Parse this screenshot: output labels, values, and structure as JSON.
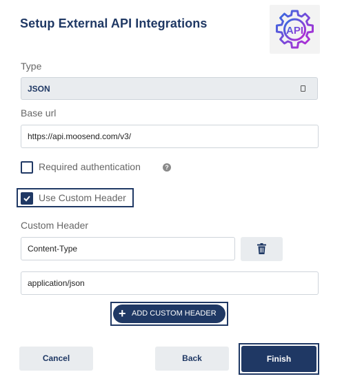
{
  "header": {
    "title": "Setup External API Integrations",
    "logo_text": "API"
  },
  "form": {
    "type": {
      "label": "Type",
      "value": "JSON"
    },
    "base_url": {
      "label": "Base url",
      "value": "https://api.moosend.com/v3/"
    },
    "required_auth": {
      "label": "Required authentication",
      "checked": false,
      "help": "?"
    },
    "use_custom_header": {
      "label": "Use Custom Header",
      "checked": true
    },
    "custom_header": {
      "label": "Custom Header",
      "key": "Content-Type",
      "value": "application/json"
    },
    "add_header_label": "ADD CUSTOM HEADER"
  },
  "footer": {
    "cancel": "Cancel",
    "back": "Back",
    "finish": "Finish"
  },
  "colors": {
    "primary": "#1f3864",
    "logo_gradient_start": "#2f6fe0",
    "logo_gradient_end": "#c026d3"
  },
  "icons": [
    "gear-api-icon",
    "dropdown-caret-icon",
    "help-icon",
    "check-icon",
    "trash-icon",
    "plus-icon"
  ]
}
